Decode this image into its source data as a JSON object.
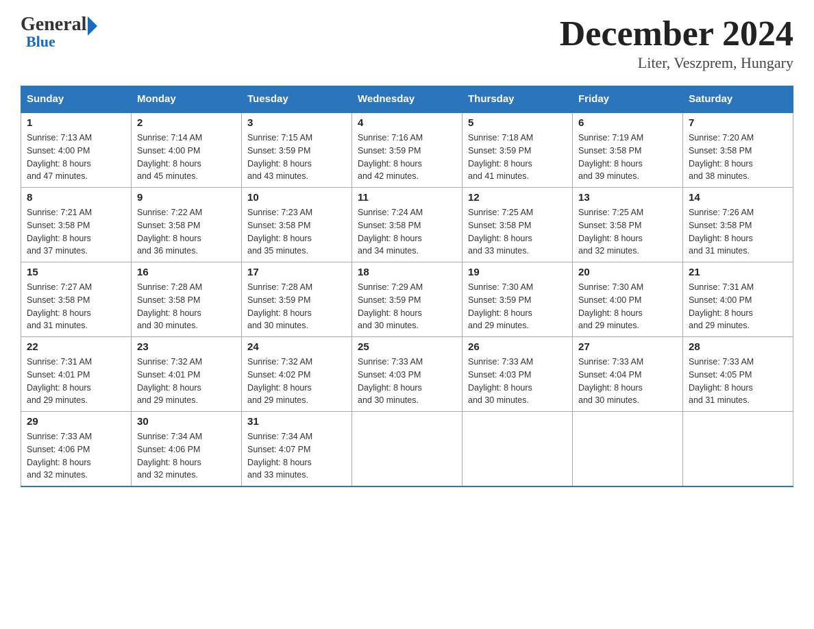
{
  "header": {
    "logo_general": "General",
    "logo_blue": "Blue",
    "month_title": "December 2024",
    "location": "Liter, Veszprem, Hungary"
  },
  "days_of_week": [
    "Sunday",
    "Monday",
    "Tuesday",
    "Wednesday",
    "Thursday",
    "Friday",
    "Saturday"
  ],
  "weeks": [
    [
      {
        "num": "1",
        "sunrise": "7:13 AM",
        "sunset": "4:00 PM",
        "daylight": "8 hours and 47 minutes."
      },
      {
        "num": "2",
        "sunrise": "7:14 AM",
        "sunset": "4:00 PM",
        "daylight": "8 hours and 45 minutes."
      },
      {
        "num": "3",
        "sunrise": "7:15 AM",
        "sunset": "3:59 PM",
        "daylight": "8 hours and 43 minutes."
      },
      {
        "num": "4",
        "sunrise": "7:16 AM",
        "sunset": "3:59 PM",
        "daylight": "8 hours and 42 minutes."
      },
      {
        "num": "5",
        "sunrise": "7:18 AM",
        "sunset": "3:59 PM",
        "daylight": "8 hours and 41 minutes."
      },
      {
        "num": "6",
        "sunrise": "7:19 AM",
        "sunset": "3:58 PM",
        "daylight": "8 hours and 39 minutes."
      },
      {
        "num": "7",
        "sunrise": "7:20 AM",
        "sunset": "3:58 PM",
        "daylight": "8 hours and 38 minutes."
      }
    ],
    [
      {
        "num": "8",
        "sunrise": "7:21 AM",
        "sunset": "3:58 PM",
        "daylight": "8 hours and 37 minutes."
      },
      {
        "num": "9",
        "sunrise": "7:22 AM",
        "sunset": "3:58 PM",
        "daylight": "8 hours and 36 minutes."
      },
      {
        "num": "10",
        "sunrise": "7:23 AM",
        "sunset": "3:58 PM",
        "daylight": "8 hours and 35 minutes."
      },
      {
        "num": "11",
        "sunrise": "7:24 AM",
        "sunset": "3:58 PM",
        "daylight": "8 hours and 34 minutes."
      },
      {
        "num": "12",
        "sunrise": "7:25 AM",
        "sunset": "3:58 PM",
        "daylight": "8 hours and 33 minutes."
      },
      {
        "num": "13",
        "sunrise": "7:25 AM",
        "sunset": "3:58 PM",
        "daylight": "8 hours and 32 minutes."
      },
      {
        "num": "14",
        "sunrise": "7:26 AM",
        "sunset": "3:58 PM",
        "daylight": "8 hours and 31 minutes."
      }
    ],
    [
      {
        "num": "15",
        "sunrise": "7:27 AM",
        "sunset": "3:58 PM",
        "daylight": "8 hours and 31 minutes."
      },
      {
        "num": "16",
        "sunrise": "7:28 AM",
        "sunset": "3:58 PM",
        "daylight": "8 hours and 30 minutes."
      },
      {
        "num": "17",
        "sunrise": "7:28 AM",
        "sunset": "3:59 PM",
        "daylight": "8 hours and 30 minutes."
      },
      {
        "num": "18",
        "sunrise": "7:29 AM",
        "sunset": "3:59 PM",
        "daylight": "8 hours and 30 minutes."
      },
      {
        "num": "19",
        "sunrise": "7:30 AM",
        "sunset": "3:59 PM",
        "daylight": "8 hours and 29 minutes."
      },
      {
        "num": "20",
        "sunrise": "7:30 AM",
        "sunset": "4:00 PM",
        "daylight": "8 hours and 29 minutes."
      },
      {
        "num": "21",
        "sunrise": "7:31 AM",
        "sunset": "4:00 PM",
        "daylight": "8 hours and 29 minutes."
      }
    ],
    [
      {
        "num": "22",
        "sunrise": "7:31 AM",
        "sunset": "4:01 PM",
        "daylight": "8 hours and 29 minutes."
      },
      {
        "num": "23",
        "sunrise": "7:32 AM",
        "sunset": "4:01 PM",
        "daylight": "8 hours and 29 minutes."
      },
      {
        "num": "24",
        "sunrise": "7:32 AM",
        "sunset": "4:02 PM",
        "daylight": "8 hours and 29 minutes."
      },
      {
        "num": "25",
        "sunrise": "7:33 AM",
        "sunset": "4:03 PM",
        "daylight": "8 hours and 30 minutes."
      },
      {
        "num": "26",
        "sunrise": "7:33 AM",
        "sunset": "4:03 PM",
        "daylight": "8 hours and 30 minutes."
      },
      {
        "num": "27",
        "sunrise": "7:33 AM",
        "sunset": "4:04 PM",
        "daylight": "8 hours and 30 minutes."
      },
      {
        "num": "28",
        "sunrise": "7:33 AM",
        "sunset": "4:05 PM",
        "daylight": "8 hours and 31 minutes."
      }
    ],
    [
      {
        "num": "29",
        "sunrise": "7:33 AM",
        "sunset": "4:06 PM",
        "daylight": "8 hours and 32 minutes."
      },
      {
        "num": "30",
        "sunrise": "7:34 AM",
        "sunset": "4:06 PM",
        "daylight": "8 hours and 32 minutes."
      },
      {
        "num": "31",
        "sunrise": "7:34 AM",
        "sunset": "4:07 PM",
        "daylight": "8 hours and 33 minutes."
      },
      null,
      null,
      null,
      null
    ]
  ],
  "labels": {
    "sunrise": "Sunrise: ",
    "sunset": "Sunset: ",
    "daylight": "Daylight: "
  }
}
